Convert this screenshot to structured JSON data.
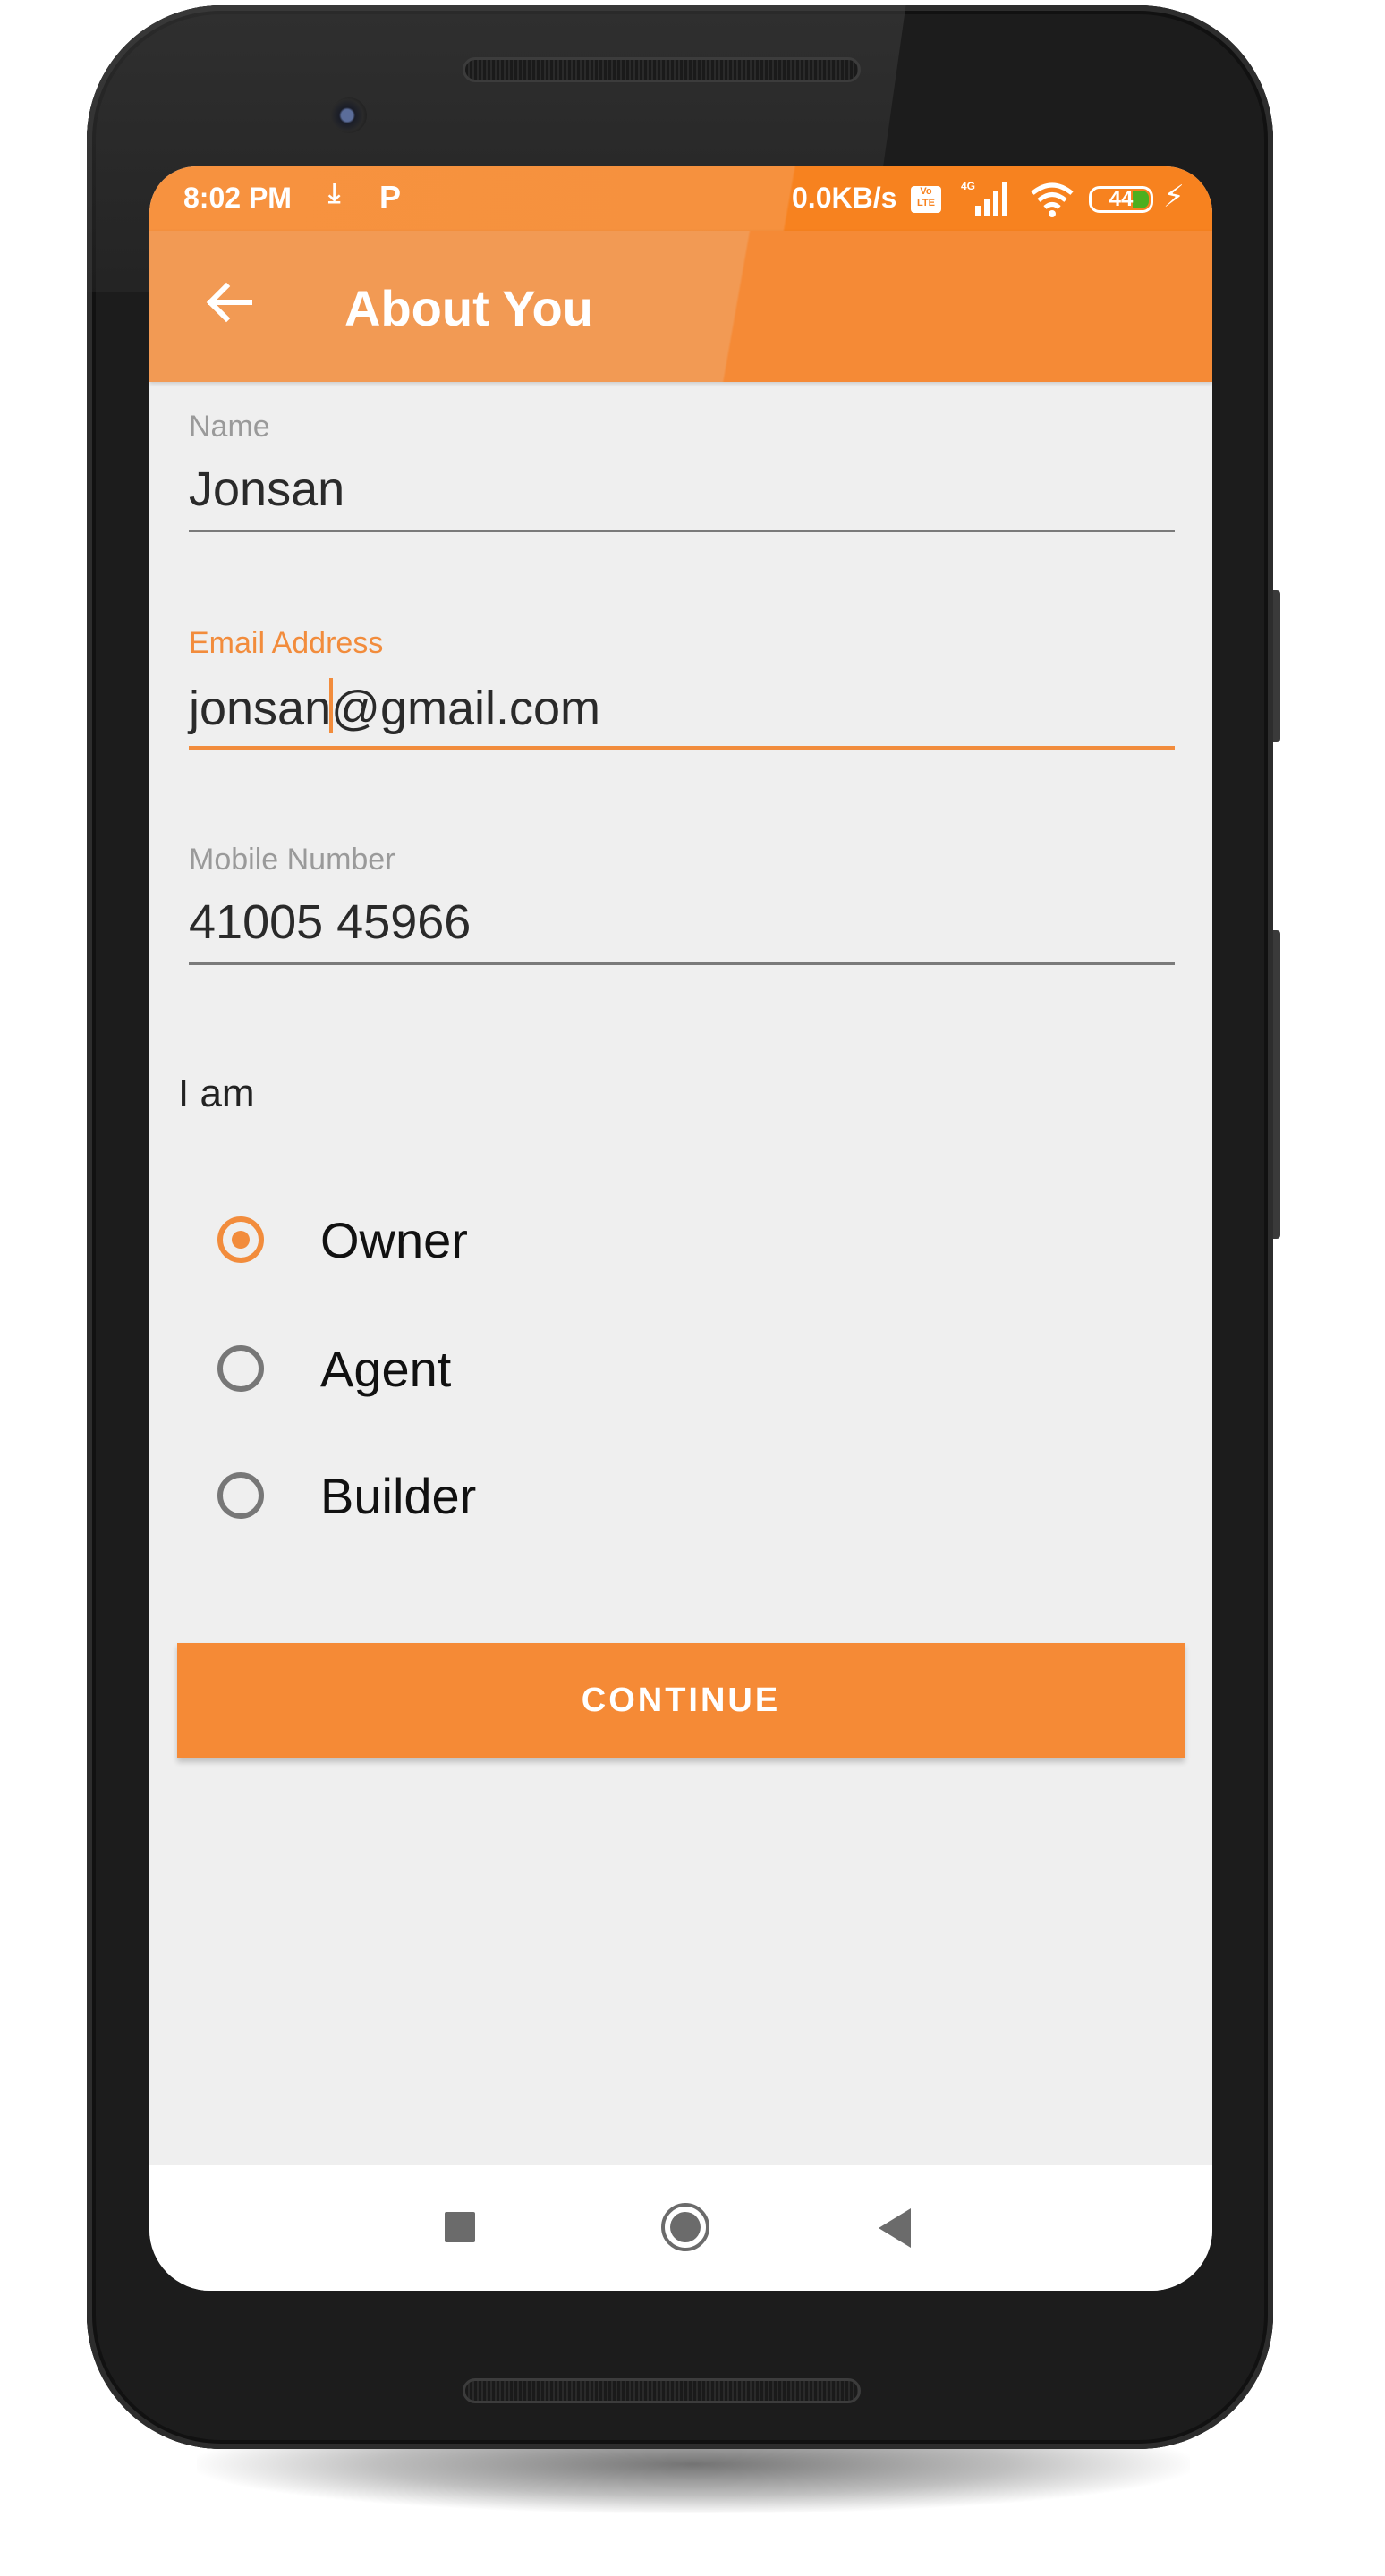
{
  "status_bar": {
    "time": "8:02 PM",
    "download_icon": "download-icon",
    "p_icon": "parking-app-icon",
    "net_speed": "0.0KB/s",
    "volte_badge": "Vo LTE",
    "network_type": "4G",
    "battery_level": "44",
    "battery_fraction": 0.44,
    "charging": true
  },
  "app_bar": {
    "back_icon": "arrow-back-icon",
    "title": "About You"
  },
  "form": {
    "name": {
      "label": "Name",
      "value": "Jonsan"
    },
    "email": {
      "label": "Email Address",
      "value_before_caret": "jonsan",
      "value_after_caret": "@gmail.com",
      "focused": true
    },
    "mobile": {
      "label": "Mobile Number",
      "value": "41005 45966"
    },
    "role_label": "I am",
    "roles": [
      {
        "label": "Owner",
        "checked": true
      },
      {
        "label": "Agent",
        "checked": false
      },
      {
        "label": "Builder",
        "checked": false
      }
    ],
    "submit_label": "CONTINUE"
  },
  "nav_bar": {
    "recent_icon": "recent-apps-icon",
    "home_icon": "home-icon",
    "back_icon": "back-triangle-icon"
  },
  "colors": {
    "accent": "#f58a36",
    "status_bar": "#f7821f",
    "background": "#efefef"
  }
}
